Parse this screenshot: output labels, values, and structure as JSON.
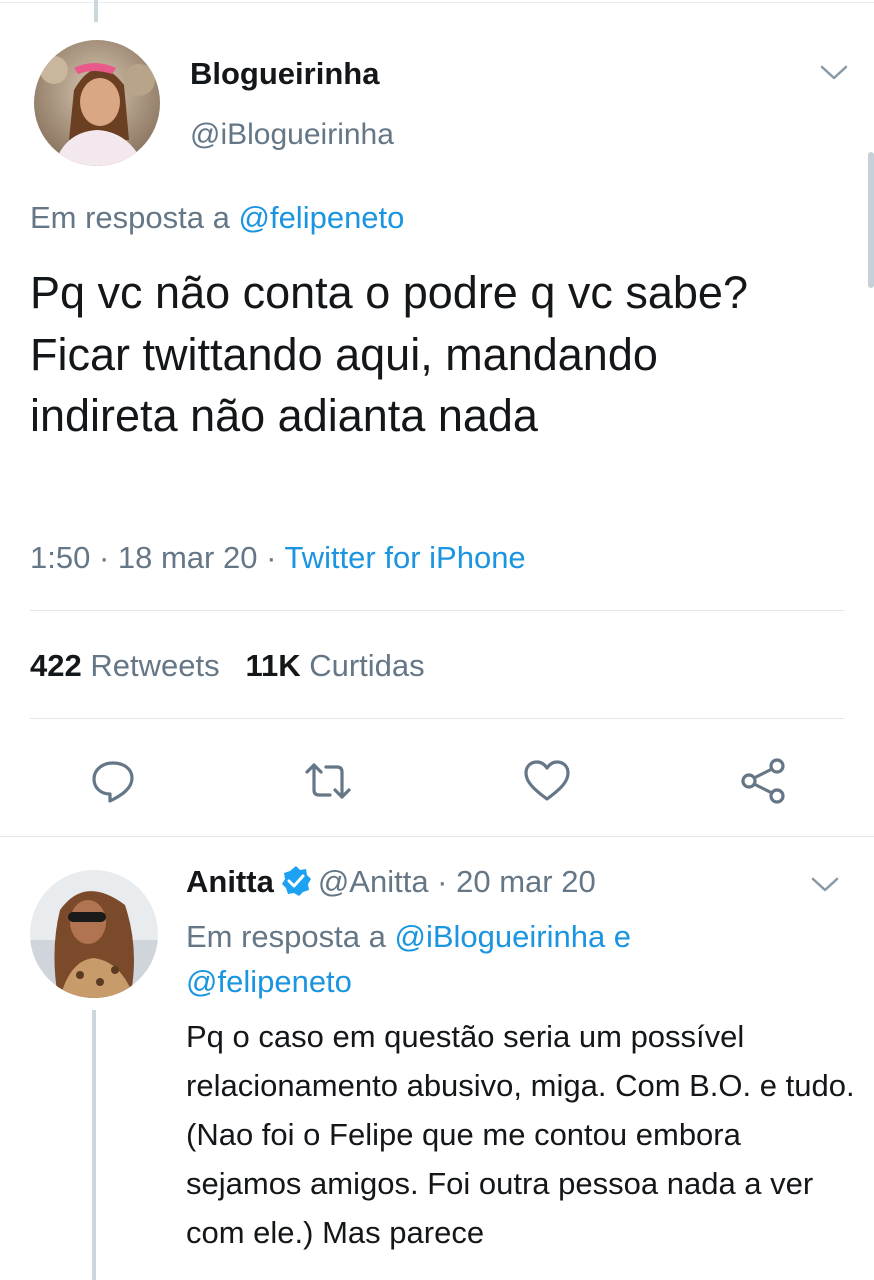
{
  "main_tweet": {
    "display_name": "Blogueirinha",
    "handle": "@iBlogueirinha",
    "reply_prefix": "Em resposta a ",
    "reply_to": "@felipeneto",
    "text": "Pq vc não conta o podre q vc sabe? Ficar twittando aqui, mandando indireta não adianta nada",
    "time_date": "1:50 · 18 mar 20 · ",
    "source": "Twitter for iPhone",
    "retweets_count": "422",
    "retweets_label": "Retweets",
    "likes_count": "11K",
    "likes_label": "Curtidas"
  },
  "reply_tweet": {
    "display_name": "Anitta",
    "handle_date": "@Anitta · 20 mar 20",
    "reply_prefix": "Em resposta a ",
    "reply_to_1": "@iBlogueirinha",
    "reply_and": " e ",
    "reply_to_2": "@felipeneto",
    "text": "Pq o caso em questão seria um possível relacionamento abusivo, miga. Com B.O. e tudo. (Nao foi o Felipe que me contou embora sejamos amigos. Foi outra pessoa nada a ver com ele.) Mas parece"
  },
  "icons": {
    "reply": "reply-icon",
    "retweet": "retweet-icon",
    "like": "heart-icon",
    "share": "share-icon",
    "verified": "verified-badge-icon",
    "menu": "chevron-down-icon"
  },
  "colors": {
    "link": "#1b95e0",
    "secondary_text": "#657786",
    "primary_text": "#14171a",
    "verified": "#1da1f2"
  }
}
